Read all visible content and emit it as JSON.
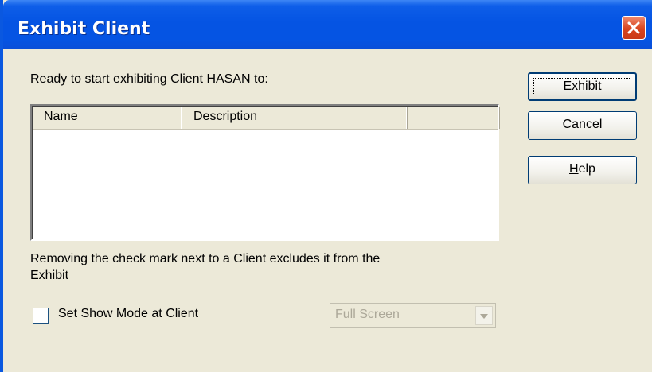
{
  "window": {
    "title": "Exhibit Client"
  },
  "dialog": {
    "intro_text": "Ready to start exhibiting Client HASAN to:",
    "list": {
      "columns": [
        "Name",
        "Description",
        ""
      ],
      "rows": []
    },
    "note_line1": "Removing the check mark next to a Client excludes it from the",
    "note_line2": "Exhibit",
    "show_mode_checkbox": {
      "label": "Set Show Mode at Client",
      "checked": false
    },
    "show_mode_select": {
      "value": "Full Screen",
      "enabled": false
    }
  },
  "buttons": {
    "exhibit": {
      "accel": "E",
      "rest": "xhibit"
    },
    "cancel": {
      "label": "Cancel"
    },
    "help": {
      "accel": "H",
      "rest": "elp"
    }
  },
  "colors": {
    "titlebar": "#0554e3",
    "dialog_bg": "#ece9d8",
    "close_button": "#d8441e",
    "disabled_text": "#aca899"
  },
  "icons": {
    "close": "close-icon",
    "dropdown": "chevron-down-icon"
  }
}
